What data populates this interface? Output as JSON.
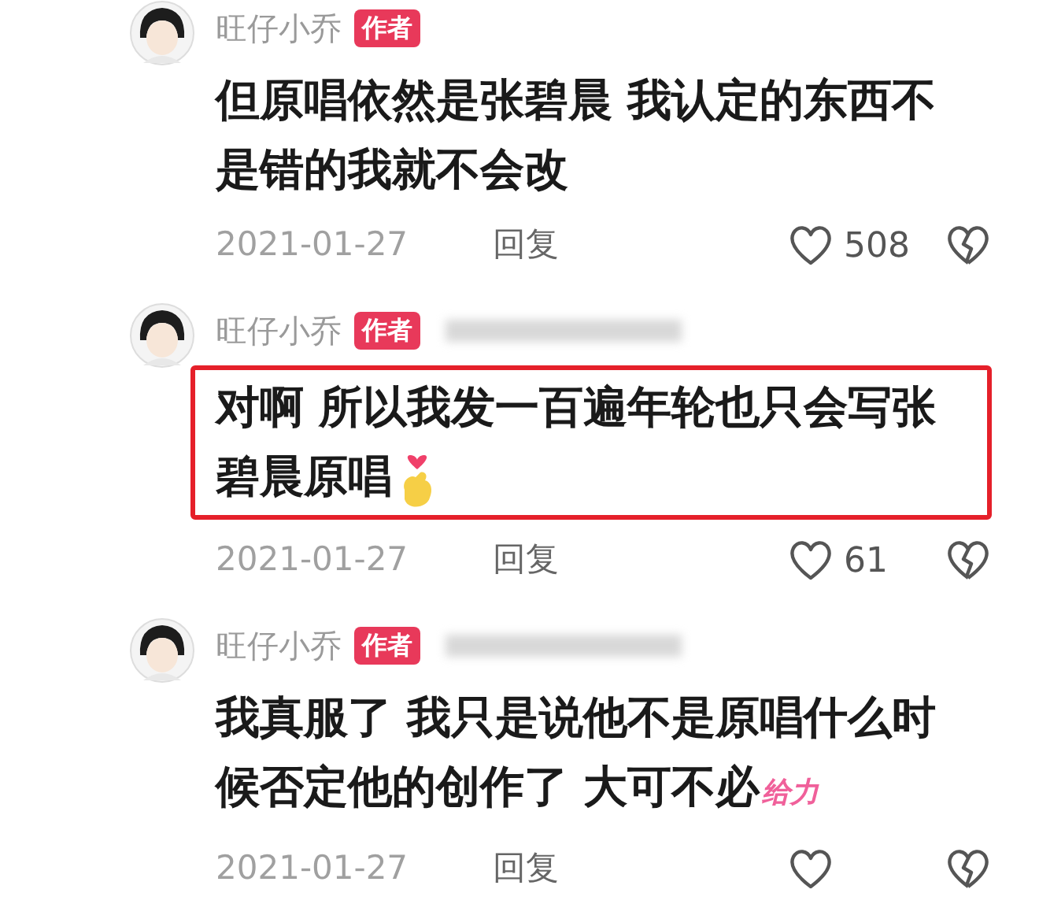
{
  "comments": [
    {
      "author": "旺仔小乔",
      "badge": "作者",
      "blurred": false,
      "highlighted": false,
      "text": "但原唱依然是张碧晨 我认定的东西不是错的我就不会改",
      "finger_heart": false,
      "date": "2021-01-27",
      "reply": "回复",
      "likes": "508"
    },
    {
      "author": "旺仔小乔",
      "badge": "作者",
      "blurred": true,
      "highlighted": true,
      "text": "对啊 所以我发一百遍年轮也只会写张碧晨原唱",
      "finger_heart": true,
      "date": "2021-01-27",
      "reply": "回复",
      "likes": "61"
    },
    {
      "author": "旺仔小乔",
      "badge": "作者",
      "blurred": true,
      "highlighted": false,
      "text": "我真服了 我只是说他不是原唱什么时候否定他的创作了 大可不必",
      "sticker": "给力",
      "finger_heart": false,
      "date": "2021-01-27",
      "reply": "回复"
    }
  ]
}
